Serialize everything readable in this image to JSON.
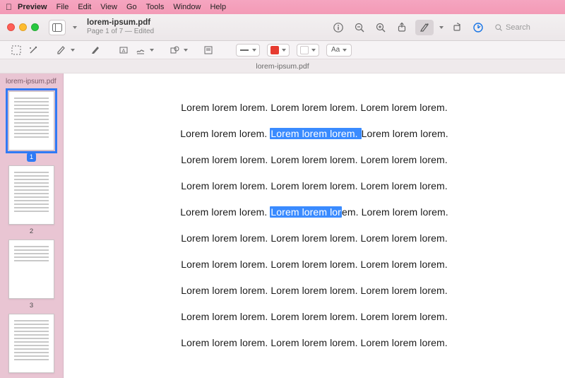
{
  "menubar": {
    "app": "Preview",
    "items": [
      "File",
      "Edit",
      "View",
      "Go",
      "Tools",
      "Window",
      "Help"
    ]
  },
  "window": {
    "title": "lorem-ipsum.pdf",
    "subtitle": "Page 1 of 7 — Edited",
    "tab_label": "lorem-ipsum.pdf",
    "search_placeholder": "Search"
  },
  "sidebar": {
    "title": "lorem-ipsum.pdf",
    "pages": [
      "1",
      "2",
      "3",
      ""
    ]
  },
  "markup": {
    "font_label": "Aa"
  },
  "document": {
    "sentence": "Lorem lorem lorem. ",
    "lines": [
      {
        "segments": [
          {
            "t": "Lorem lorem lorem. Lorem lorem lorem. Lorem lorem lorem."
          }
        ]
      },
      {
        "segments": [
          {
            "t": "Lorem lorem lorem. "
          },
          {
            "t": "Lorem lorem lorem. ",
            "hl": true
          },
          {
            "t": "Lorem lorem lorem."
          }
        ]
      },
      {
        "segments": [
          {
            "t": "Lorem lorem lorem. Lorem lorem lorem. Lorem lorem lorem."
          }
        ]
      },
      {
        "segments": [
          {
            "t": "Lorem lorem lorem. Lorem lorem lorem. Lorem lorem lorem."
          }
        ]
      },
      {
        "segments": [
          {
            "t": "Lorem lorem lorem. "
          },
          {
            "t": "Lorem lorem lor",
            "hl": true
          },
          {
            "t": "em. Lorem lorem lorem."
          }
        ]
      },
      {
        "segments": [
          {
            "t": "Lorem lorem lorem. Lorem lorem lorem. Lorem lorem lorem."
          }
        ]
      },
      {
        "segments": [
          {
            "t": "Lorem lorem lorem. Lorem lorem lorem. Lorem lorem lorem."
          }
        ]
      },
      {
        "segments": [
          {
            "t": "Lorem lorem lorem. Lorem lorem lorem. Lorem lorem lorem."
          }
        ]
      },
      {
        "segments": [
          {
            "t": "Lorem lorem lorem. Lorem lorem lorem. Lorem lorem lorem."
          }
        ]
      },
      {
        "segments": [
          {
            "t": "Lorem lorem lorem. Lorem lorem lorem. Lorem lorem lorem."
          }
        ]
      }
    ]
  }
}
